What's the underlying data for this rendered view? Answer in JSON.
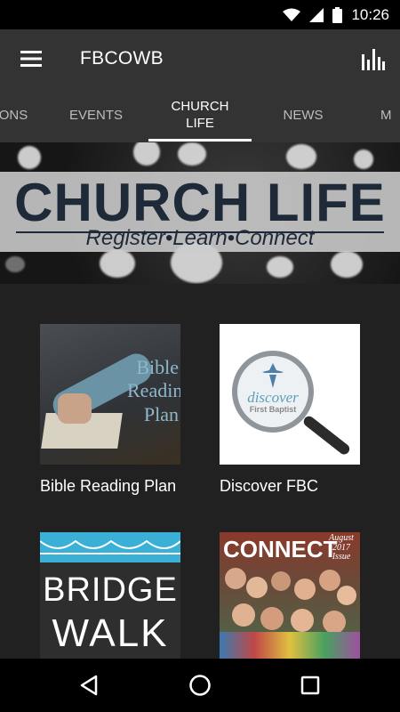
{
  "status": {
    "time": "10:26"
  },
  "app": {
    "title": "FBCOWB"
  },
  "tabs": [
    {
      "label": "ONS"
    },
    {
      "label": "EVENTS"
    },
    {
      "label": "CHURCH\nLIFE",
      "active": true
    },
    {
      "label": "NEWS"
    },
    {
      "label": "M"
    }
  ],
  "banner": {
    "title": "CHURCH LIFE",
    "subtitle": "Register•Learn•Connect"
  },
  "cards": [
    {
      "label": "Bible Reading Plan",
      "art": [
        "Bible",
        "Reading",
        "Plan"
      ]
    },
    {
      "label": "Discover FBC",
      "art": [
        "discover",
        "First Baptist"
      ]
    },
    {
      "label": "",
      "art": [
        "BRIDGE",
        "WALK"
      ]
    },
    {
      "label": "",
      "art": [
        "CONNECT",
        "August",
        "2017",
        "Issue"
      ]
    }
  ],
  "icons": {
    "menu": "hamburger-icon",
    "stats": "bar-chart-icon",
    "back": "back-triangle-icon",
    "home": "home-circle-icon",
    "recents": "recents-square-icon"
  },
  "colors": {
    "app_bar": "#333333",
    "background": "#212121",
    "banner_text": "#1e2a38",
    "bridge_blue": "#3ab0d6"
  }
}
